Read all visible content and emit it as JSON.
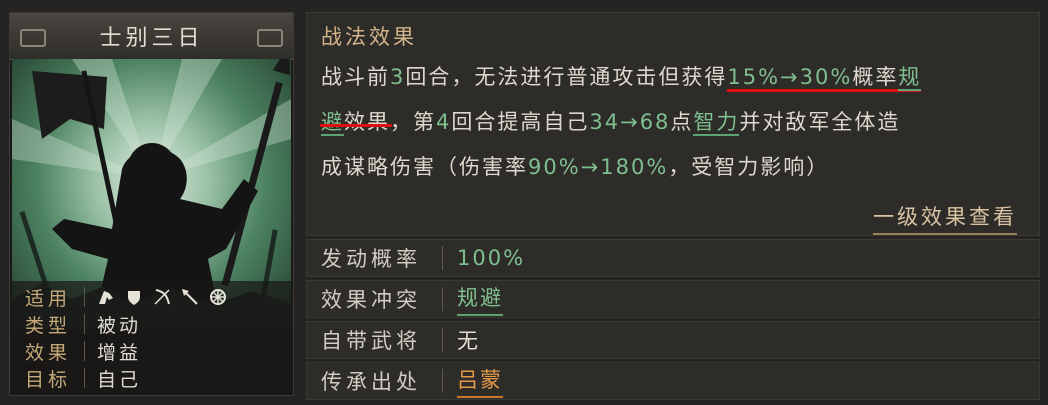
{
  "card": {
    "title": "士别三日",
    "attributes": [
      {
        "label": "适用",
        "value": "",
        "icons": [
          "cavalry-icon",
          "shield-icon",
          "bow-icon",
          "spear-icon",
          "chariot-wheel-icon"
        ]
      },
      {
        "label": "类型",
        "value": "被动"
      },
      {
        "label": "效果",
        "value": "增益"
      },
      {
        "label": "目标",
        "value": "自己"
      }
    ]
  },
  "effect": {
    "title": "战法效果",
    "line1": {
      "t1": "战斗前",
      "n1": "3",
      "t2": "回合，无法进行普通攻击但获得",
      "rate": "15%→30%",
      "t3": "概率",
      "kw_a": "规"
    },
    "line2": {
      "kw_b": "避",
      "t1": "效果，第",
      "n1": "4",
      "t2": "回合提高自己",
      "value": "34→68",
      "t3": "点",
      "kw": "智力",
      "t4": "并对敌军全体造"
    },
    "line3": {
      "t1": "成谋略伤害（伤害率",
      "rate": "90%→180%",
      "t2": "，受智力影响）"
    },
    "level_link": "一级效果查看"
  },
  "info": {
    "rate": {
      "label": "发动概率",
      "value": "100%"
    },
    "conflict": {
      "label": "效果冲突",
      "value": "规避"
    },
    "general": {
      "label": "自带武将",
      "value": "无"
    },
    "source": {
      "label": "传承出处",
      "value": "吕蒙"
    }
  },
  "colors": {
    "highlight_green": "#7fbf8f",
    "accent_gold": "#d3b489",
    "link_orange": "#e49a4a",
    "annotation_red": "#e01010"
  }
}
